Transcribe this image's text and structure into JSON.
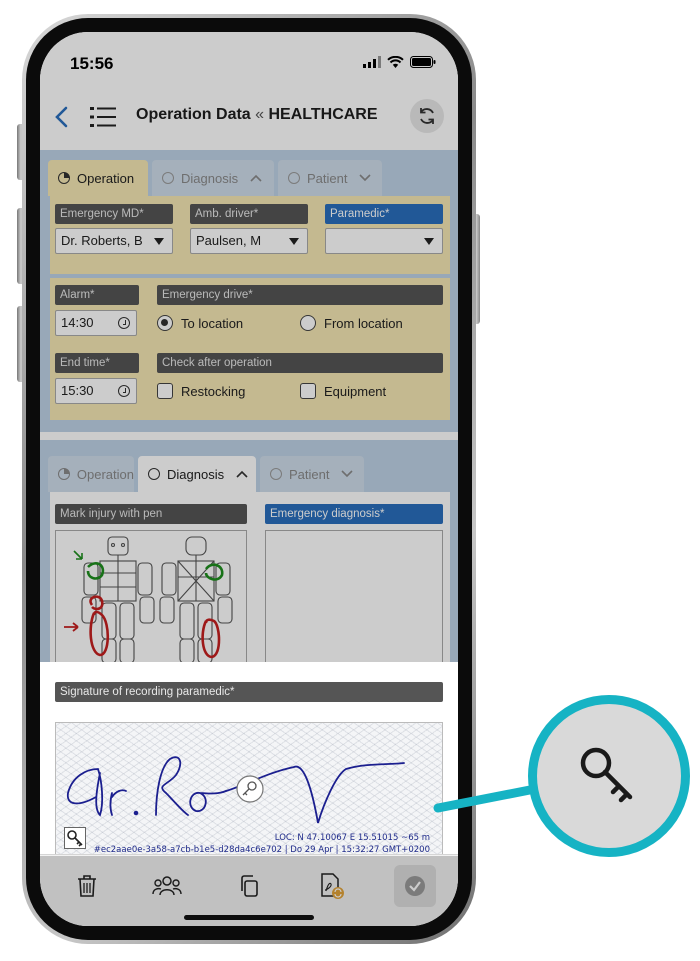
{
  "status": {
    "time": "15:56"
  },
  "header": {
    "title": "Operation Data",
    "separator": "«",
    "context": "HEALTHCARE"
  },
  "tabs_top": [
    {
      "label": "Operation"
    },
    {
      "label": "Diagnosis"
    },
    {
      "label": "Patient"
    }
  ],
  "crew": {
    "emergency_md": {
      "label": "Emergency MD*",
      "value": "Dr. Roberts, B"
    },
    "amb_driver": {
      "label": "Amb. driver*",
      "value": "Paulsen, M"
    },
    "paramedic": {
      "label": "Paramedic*",
      "value": ""
    }
  },
  "alarm": {
    "label": "Alarm*",
    "value": "14:30"
  },
  "emergency_drive": {
    "label": "Emergency drive*",
    "options": [
      {
        "label": "To location",
        "selected": true
      },
      {
        "label": "From location",
        "selected": false
      }
    ]
  },
  "end_time": {
    "label": "End time*",
    "value": "15:30"
  },
  "check_after": {
    "label": "Check after operation",
    "options": [
      {
        "label": "Restocking",
        "checked": false
      },
      {
        "label": "Equipment",
        "checked": false
      }
    ]
  },
  "tabs_second": [
    {
      "label": "Operation"
    },
    {
      "label": "Diagnosis"
    },
    {
      "label": "Patient"
    }
  ],
  "diagnosis": {
    "mark_injury_label": "Mark injury with pen",
    "emergency_diagnosis_label": "Emergency diagnosis*",
    "emergency_diagnosis_value": ""
  },
  "signature": {
    "label": "Signature of recording paramedic*",
    "loc": "LOC: N 47.10067  E 15.51015  ~65 m",
    "hash": "#ec2aae0e-3a58-a7cb-b1e5-d28da4c6e702 | Do 29 Apr | 15:32:27 GMT+0200"
  },
  "colors": {
    "accent": "#2a6fbd",
    "callout": "#16b3c4",
    "signature_ink": "#1b1f8f",
    "injury_green": "#1e8f1e",
    "injury_red": "#c62020"
  },
  "icons": [
    "back-chevron-icon",
    "list-menu-icon",
    "sync-icon",
    "trash-icon",
    "group-icon",
    "copy-icon",
    "pdf-icon",
    "check-icon",
    "key-icon"
  ]
}
